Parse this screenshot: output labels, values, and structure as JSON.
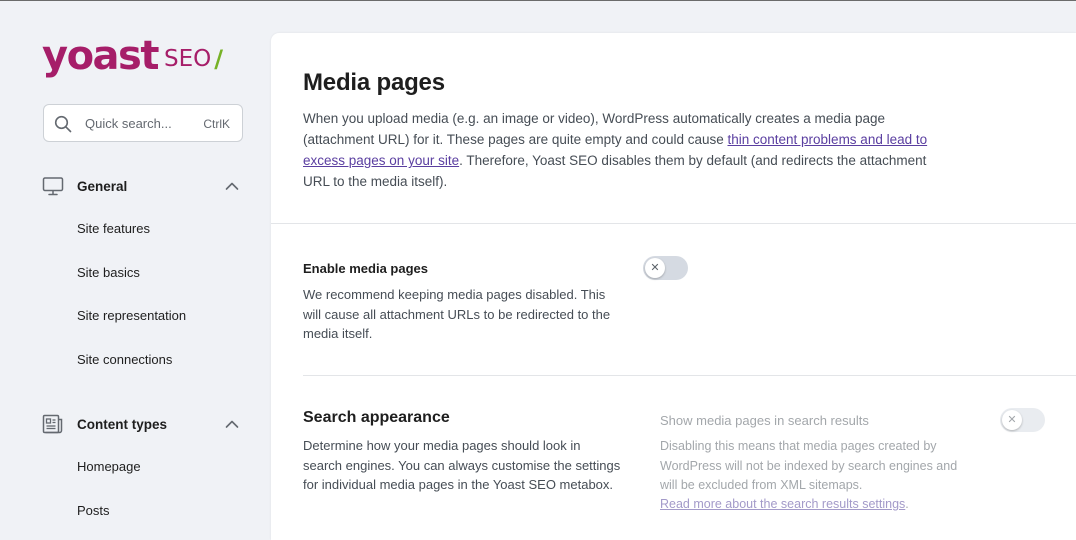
{
  "brand": {
    "logo_main": "yoast",
    "logo_seo": "SEO",
    "logo_slash": "/",
    "color": "#a61e69",
    "accent": "#77b227"
  },
  "search": {
    "placeholder": "Quick search...",
    "shortcut": "CtrlK"
  },
  "sidebar": {
    "groups": [
      {
        "label": "General",
        "icon": "monitor-icon",
        "expanded": true,
        "items": [
          "Site features",
          "Site basics",
          "Site representation",
          "Site connections"
        ]
      },
      {
        "label": "Content types",
        "icon": "content-types-icon",
        "expanded": true,
        "items": [
          "Homepage",
          "Posts"
        ]
      }
    ]
  },
  "main": {
    "title": "Media pages",
    "intro_before": "When you upload media (e.g. an image or video), WordPress automatically creates a media page (attachment URL) for it. These pages are quite empty and could cause ",
    "intro_link": "thin content problems and lead to excess pages on your site",
    "intro_after": ". Therefore, Yoast SEO disables them by default (and redirects the attachment URL to the media itself).",
    "enable": {
      "label": "Enable media pages",
      "description": "We recommend keeping media pages disabled. This will cause all attachment URLs to be redirected to the media itself.",
      "toggle_on": false
    },
    "search_appearance": {
      "title": "Search appearance",
      "description": "Determine how your media pages should look in search engines. You can always customise the settings for individual media pages in the Yoast SEO metabox.",
      "show_label": "Show media pages in search results",
      "show_description": "Disabling this means that media pages created by WordPress will not be indexed by search engines and will be excluded from XML sitemaps.",
      "read_more": "Read more about the search results settings",
      "read_more_after": ".",
      "toggle_on": false,
      "toggle_disabled": true
    }
  }
}
